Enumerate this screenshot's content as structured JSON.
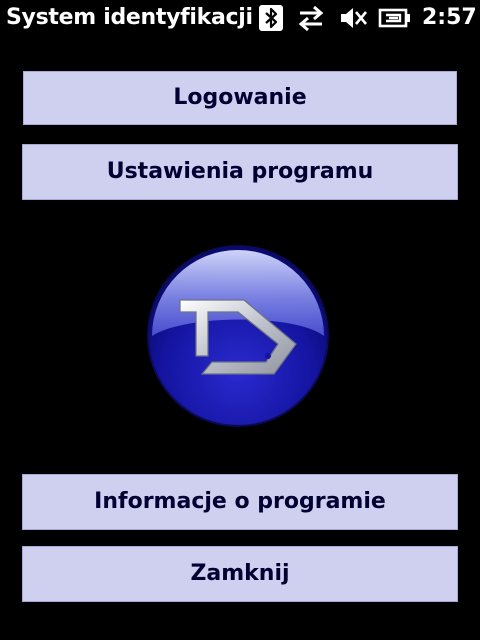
{
  "titlebar": {
    "title": "System identyfikacji",
    "clock": "2:57",
    "icons": [
      "bluetooth-icon",
      "data-connection-icon",
      "volume-muted-icon",
      "battery-charging-icon"
    ]
  },
  "menu": {
    "login_label": "Logowanie",
    "settings_label": "Ustawienia programu",
    "info_label": "Informacje o programie",
    "close_label": "Zamknij"
  },
  "colors": {
    "background": "#000000",
    "button_fill": "#cfcfef",
    "button_text": "#000033",
    "logo_blue": "#1a1aa6"
  }
}
